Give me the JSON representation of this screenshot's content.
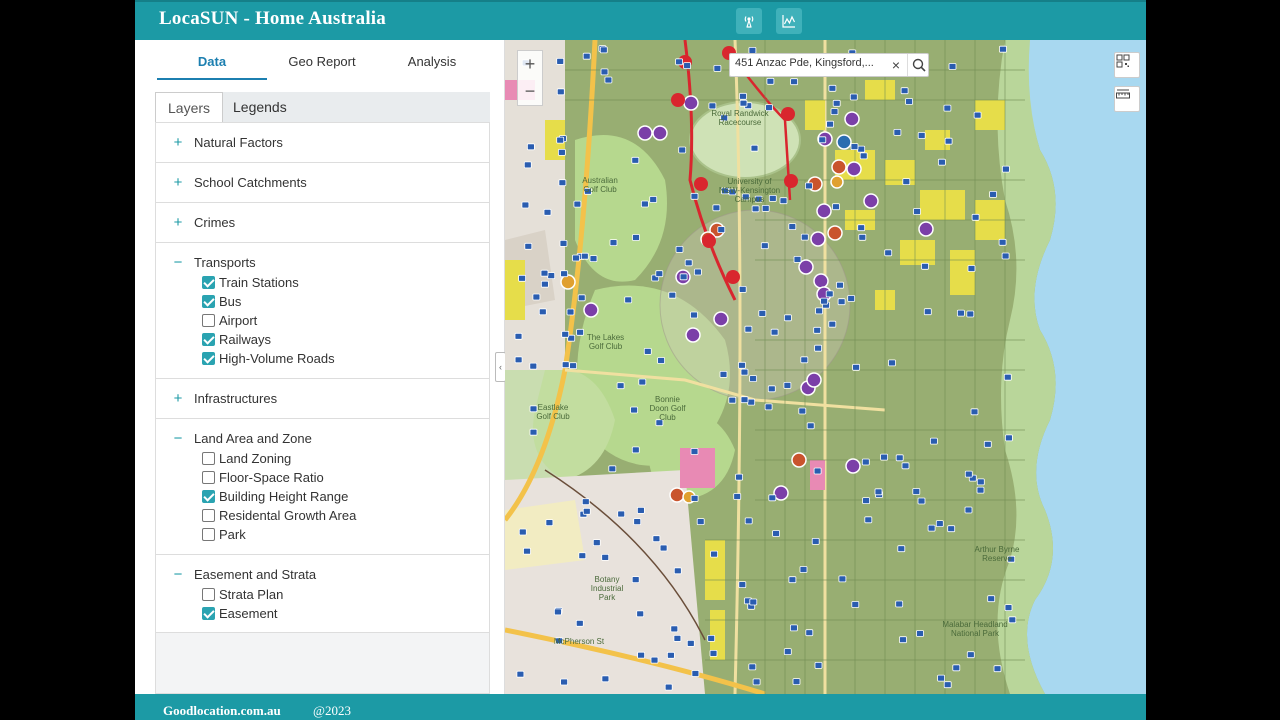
{
  "header": {
    "title": "LocaSUN - Home Australia",
    "icons": [
      "signal-tower-icon",
      "chart-icon"
    ]
  },
  "sidebar": {
    "main_tabs": [
      {
        "label": "Data",
        "active": true
      },
      {
        "label": "Geo Report",
        "active": false
      },
      {
        "label": "Analysis",
        "active": false
      }
    ],
    "sub_tabs": [
      {
        "label": "Layers",
        "active": true
      },
      {
        "label": "Legends",
        "active": false
      }
    ],
    "groups": [
      {
        "title": "Natural Factors",
        "expanded": false,
        "items": []
      },
      {
        "title": "School Catchments",
        "expanded": false,
        "items": []
      },
      {
        "title": "Crimes",
        "expanded": false,
        "items": []
      },
      {
        "title": "Transports",
        "expanded": true,
        "items": [
          {
            "label": "Train Stations",
            "checked": true
          },
          {
            "label": "Bus",
            "checked": true
          },
          {
            "label": "Airport",
            "checked": false
          },
          {
            "label": "Railways",
            "checked": true
          },
          {
            "label": "High-Volume Roads",
            "checked": true
          }
        ]
      },
      {
        "title": "Infrastructures",
        "expanded": false,
        "items": []
      },
      {
        "title": "Land Area and Zone",
        "expanded": true,
        "items": [
          {
            "label": "Land Zoning",
            "checked": false
          },
          {
            "label": "Floor-Space Ratio",
            "checked": false
          },
          {
            "label": "Building Height Range",
            "checked": true
          },
          {
            "label": "Residental Growth Area",
            "checked": false
          },
          {
            "label": "Park",
            "checked": false
          }
        ]
      },
      {
        "title": "Easement and Strata",
        "expanded": true,
        "items": [
          {
            "label": "Strata Plan",
            "checked": false
          },
          {
            "label": "Easement",
            "checked": true
          }
        ]
      }
    ]
  },
  "map": {
    "search_value": "451 Anzac Pde, Kingsford,...",
    "zoom_in": "+",
    "zoom_out": "−",
    "labels": {
      "royal_randwick": "Royal Randwick Racecourse",
      "unsw": "University of NSW-Kensington Campus",
      "australian_golf": "Australian Golf Club",
      "lakes_golf": "The Lakes Golf Club",
      "bonnie_doon": "Bonnie Doon Golf Club",
      "eastlake": "Eastlake Golf Club",
      "botany": "Botany Industrial Park",
      "mcpherson": "McPherson St",
      "arthur_byrne": "Arthur Byrne Reserve",
      "malabar": "Malabar Headland National Park"
    },
    "colors": {
      "residential": "#8fa86a",
      "height_zone": "#e6dd4a",
      "bus_stop": "#2a5db0",
      "railway": "#d9262e",
      "school_marker": "#7b3fa8",
      "water": "#a8d8f0"
    }
  },
  "footer": {
    "site": "Goodlocation.com.au",
    "year": "@2023"
  },
  "colors": {
    "accent": "#1c9aa5",
    "tab_active": "#1c7fb0",
    "checkbox": "#2aa3b1"
  }
}
